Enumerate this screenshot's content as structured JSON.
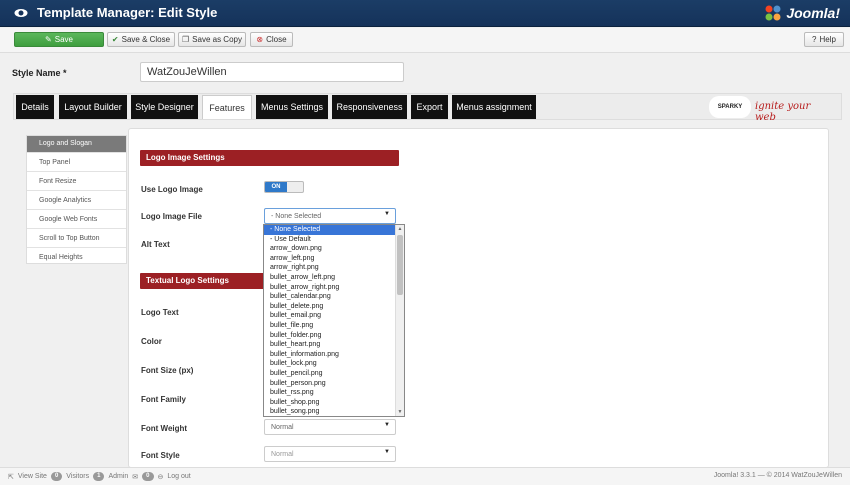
{
  "header": {
    "title": "Template Manager: Edit Style",
    "brand": "Joomla!"
  },
  "toolbar": {
    "save": "Save",
    "save_close": "Save & Close",
    "save_as_copy": "Save as Copy",
    "close": "Close",
    "help": "Help"
  },
  "style": {
    "label": "Style Name *",
    "value": "WatZouJeWillen"
  },
  "tabs": [
    "Details",
    "Layout Builder",
    "Style Designer",
    "Features",
    "Menus Settings",
    "Responsiveness",
    "Export",
    "Menus assignment"
  ],
  "active_tab": "Features",
  "sparky": {
    "badge": "SPARKY",
    "tagline": "ignite your web"
  },
  "sidebar": [
    "Logo and Slogan",
    "Top Panel",
    "Font Resize",
    "Google Analytics",
    "Google Web Fonts",
    "Scroll to Top Button",
    "Equal Heights"
  ],
  "sections": {
    "logo_image": "Logo Image Settings",
    "textual_logo": "Textual Logo Settings"
  },
  "fields": {
    "use_logo_image": "Use Logo Image",
    "toggle_on": "ON",
    "logo_image_file": "Logo Image File",
    "logo_image_file_value": "- None Selected",
    "alt_text": "Alt Text",
    "logo_text": "Logo Text",
    "color": "Color",
    "font_size": "Font Size (px)",
    "font_family": "Font Family",
    "font_weight": "Font Weight",
    "font_weight_value": "Normal",
    "font_style": "Font Style",
    "font_style_value": "Normal"
  },
  "dropdown_options": [
    "- None Selected",
    "- Use Default",
    "arrow_down.png",
    "arrow_left.png",
    "arrow_right.png",
    "bullet_arrow_left.png",
    "bullet_arrow_right.png",
    "bullet_calendar.png",
    "bullet_delete.png",
    "bullet_email.png",
    "bullet_file.png",
    "bullet_folder.png",
    "bullet_heart.png",
    "bullet_information.png",
    "bullet_lock.png",
    "bullet_pencil.png",
    "bullet_person.png",
    "bullet_rss.png",
    "bullet_shop.png",
    "bullet_song.png"
  ],
  "status": {
    "view_site": "View Site",
    "visitors_count": "0",
    "visitors": "Visitors",
    "admin_count": "1",
    "admin": "Admin",
    "messages_count": "0",
    "logout": "Log out",
    "footer": "Joomla! 3.3.1 — © 2014 WatZouJeWillen"
  }
}
